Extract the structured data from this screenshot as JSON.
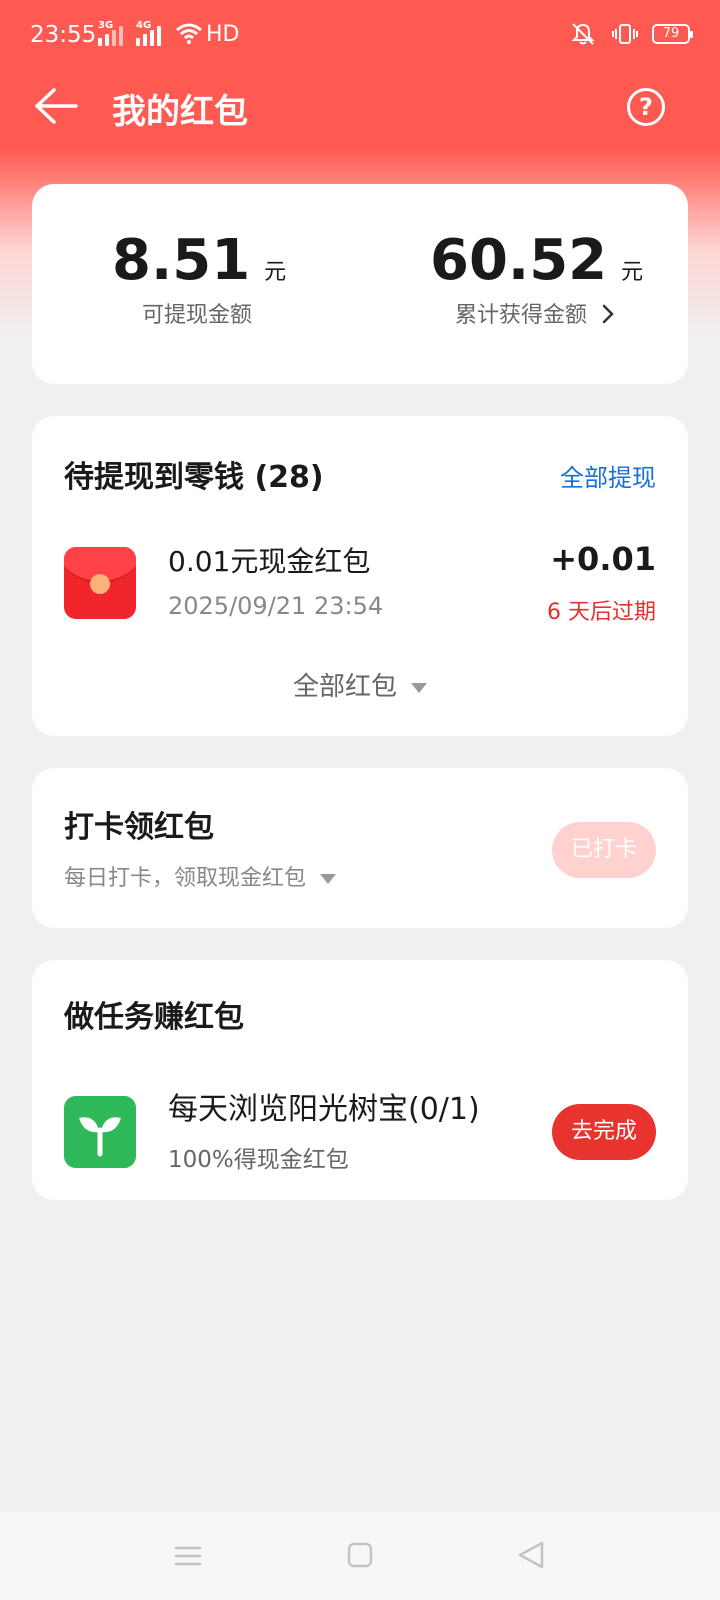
{
  "status_bar": {
    "time": "23:55",
    "sim1_tag": "3G",
    "sim2_tag": "4G",
    "hd_label": "HD",
    "battery": "79",
    "icons": [
      "signal-icon",
      "wifi-icon",
      "mute-vibrate-icon",
      "vibrate-icon",
      "battery-icon"
    ]
  },
  "header": {
    "title": "我的红包",
    "help_label": "?"
  },
  "summary": {
    "withdrawable_amount": "8.51",
    "withdrawable_unit": "元",
    "withdrawable_label": "可提现金额",
    "total_amount": "60.52",
    "total_unit": "元",
    "total_label": "累计获得金额"
  },
  "pending": {
    "title": "待提现到零钱 (28)",
    "withdraw_all_label": "全部提现",
    "items": [
      {
        "title": "0.01元现金红包",
        "time": "2025/09/21 23:54",
        "amount": "+0.01",
        "expire": "6 天后过期"
      }
    ],
    "all_envelopes_label": "全部红包"
  },
  "checkin": {
    "title": "打卡领红包",
    "subtitle": "每日打卡，领取现金红包",
    "button_label": "已打卡"
  },
  "tasks": {
    "title": "做任务赚红包",
    "items": [
      {
        "title": "每天浏览阳光树宝(0/1)",
        "subtitle": "100%得现金红包",
        "button_label": "去完成"
      }
    ]
  },
  "colors": {
    "brand_red": "#ff5a52",
    "accent_blue": "#1a6fd8",
    "warning_red": "#e0332e",
    "task_green": "#2fb85a"
  }
}
